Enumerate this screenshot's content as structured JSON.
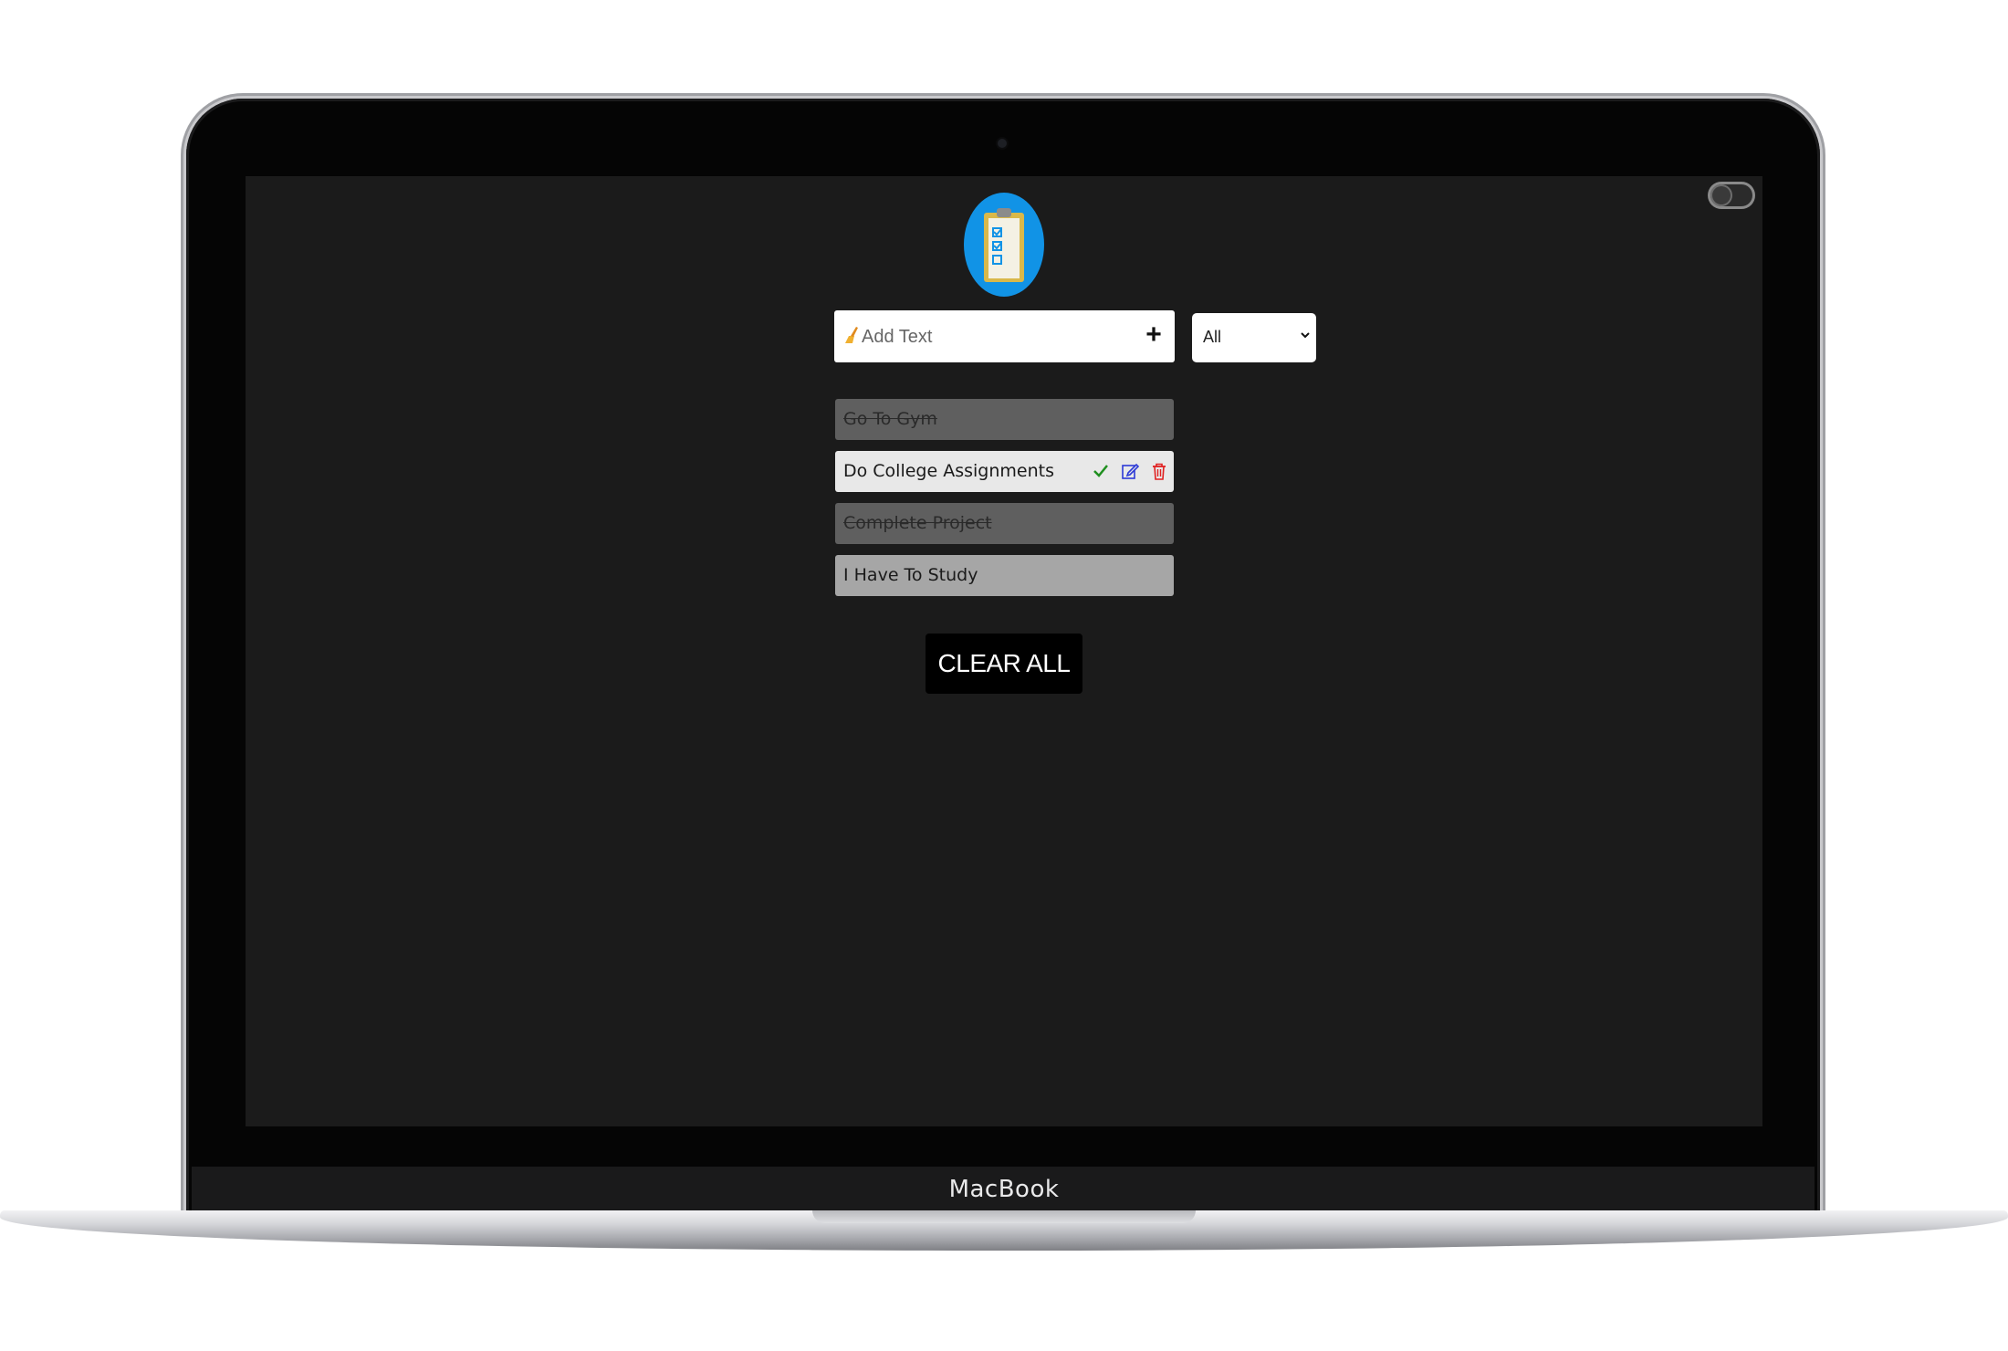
{
  "device": {
    "brand_label": "MacBook"
  },
  "app": {
    "logo_icon": "clipboard-checklist-icon",
    "add_input": {
      "placeholder": "Add Text",
      "value": ""
    },
    "add_button_label": "+",
    "filter": {
      "selected": "All"
    },
    "todos": [
      {
        "text": "Go To Gym",
        "state": "done"
      },
      {
        "text": "Do College Assignments",
        "state": "active"
      },
      {
        "text": "Complete Project",
        "state": "done"
      },
      {
        "text": "I Have To Study",
        "state": "pending"
      }
    ],
    "clear_all_label": "CLEAR ALL",
    "colors": {
      "screen_bg": "#1b1b1b",
      "logo_bg": "#1193e6",
      "done_item": "#5f5f5f",
      "active_item": "#e8e8e8",
      "pending_item": "#a6a6a6",
      "check": "#1f8f1f",
      "edit": "#2d3ad6",
      "delete": "#e02020"
    }
  }
}
